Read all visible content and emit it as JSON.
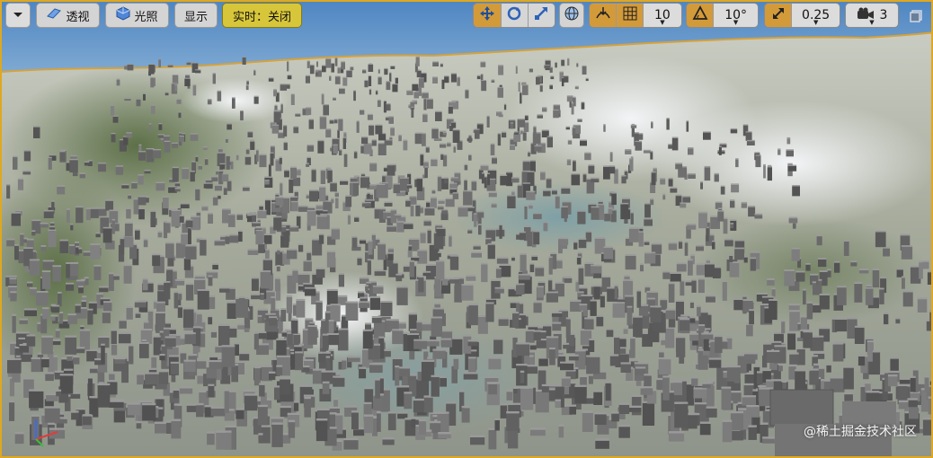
{
  "toolbar": {
    "menu_icon": "chevron-down-icon",
    "perspective_label": "透视",
    "lighting_label": "光照",
    "show_label": "显示",
    "realtime_label": "实时：关闭",
    "grid_snap_value": "10",
    "rotation_snap_value": "10°",
    "scale_snap_value": "0.25",
    "camera_speed_value": "3"
  },
  "watermark": "@稀土掘金技术社区",
  "colors": {
    "sky": "#5a8fc8",
    "frame": "#e0a81e",
    "active_tool": "#d39a3a",
    "realtime_button": "#d8c63a"
  }
}
